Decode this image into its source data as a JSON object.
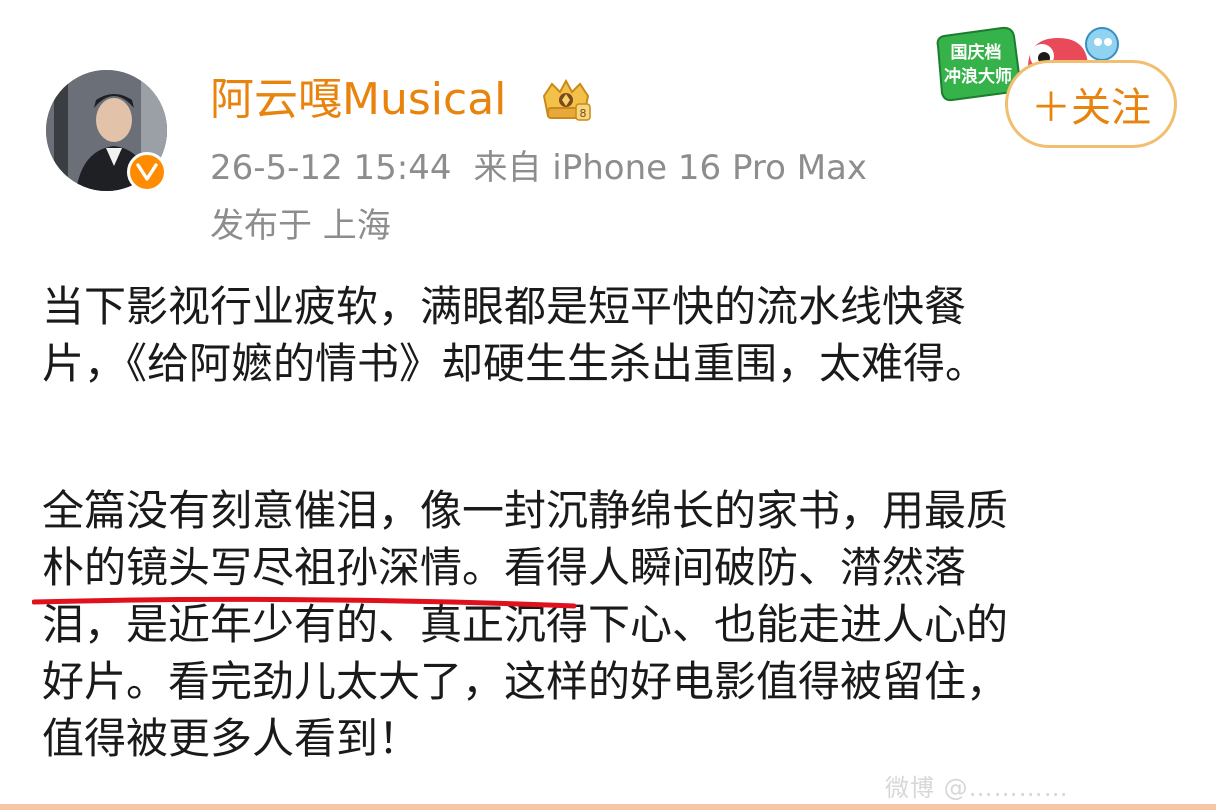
{
  "post": {
    "username": "阿云嘎Musical",
    "timestamp": "26-5-12 15:44",
    "source": "来自 iPhone 16 Pro Max",
    "location": "发布于 上海",
    "follow_label": "＋关注",
    "banner_text_line1": "国庆档",
    "banner_text_line2": "冲浪大师",
    "paragraph1": [
      "当下影视行业疲软，满眼都是短平快的流水线快餐",
      "片，《给阿嬷的情书》却硬生生杀出重围，太难得。"
    ],
    "paragraph2": [
      "全篇没有刻意催泪，像一封沉静绵长的家书，用最质",
      "朴的镜头写尽祖孙深情。看得人瞬间破防、潸然落",
      "泪，是近年少有的、真正沉得下心、也能走进人心的",
      "好片。看完劲儿太大了，这样的好电影值得被留住，",
      "值得被更多人看到！"
    ],
    "watermark": "微博 @…………"
  },
  "icons": {
    "verified": "verified-badge-icon",
    "crown": "crown-badge-icon"
  },
  "colors": {
    "username": "#e8830e",
    "meta": "#8d8d8d",
    "follow_border": "#f2be6f",
    "underline": "#e0101c",
    "verified": "#ff8c00"
  }
}
